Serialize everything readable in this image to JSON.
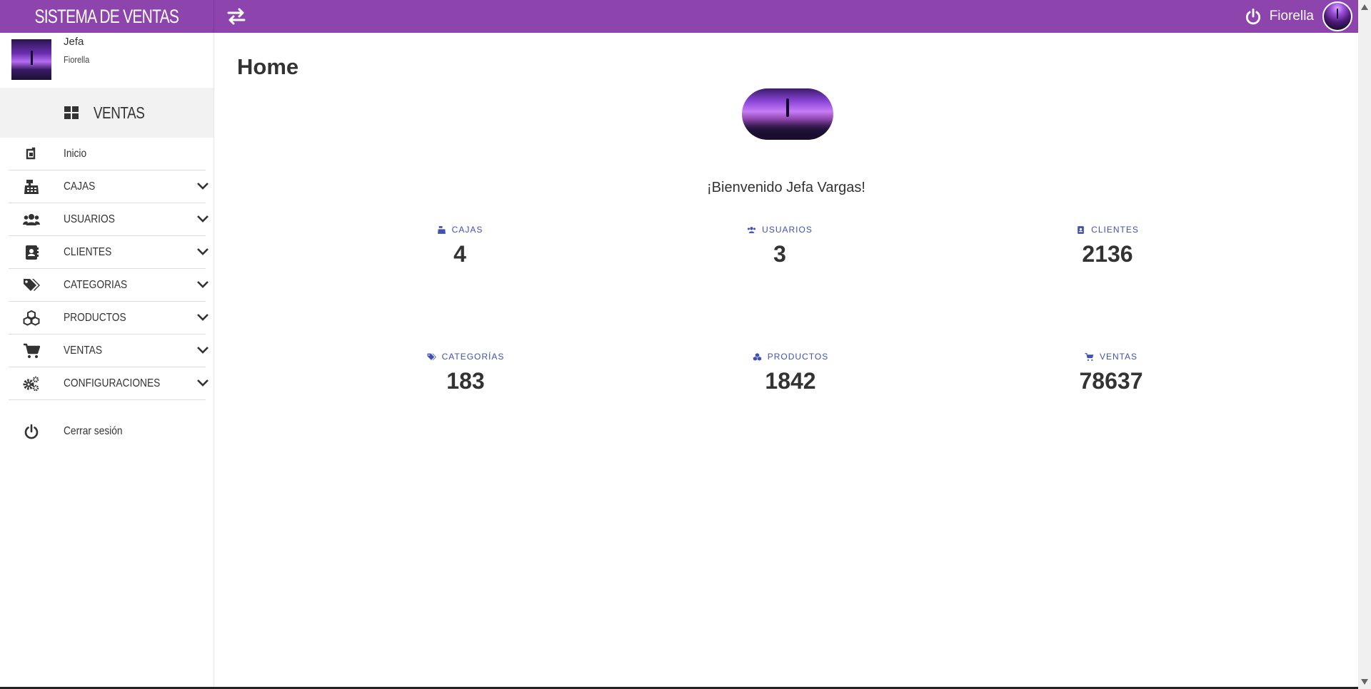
{
  "app": {
    "title": "SISTEMA DE VENTAS",
    "accent_color": "#8e44ad",
    "stat_label_color": "#3f51b5"
  },
  "topbar": {
    "toggle_icon": "exchange-arrows-icon",
    "power_icon": "power-icon",
    "username": "Fiorella",
    "avatar": "user-avatar"
  },
  "sidebar": {
    "profile": {
      "name": "Jefa",
      "subtitle": "Fiorella"
    },
    "section": {
      "icon": "grid-icon",
      "label": "VENTAS"
    },
    "items": [
      {
        "label": "Inicio",
        "icon": "home-icon",
        "has_chevron": false
      },
      {
        "label": "CAJAS",
        "icon": "cash-register-icon",
        "has_chevron": true
      },
      {
        "label": "USUARIOS",
        "icon": "users-icon",
        "has_chevron": true
      },
      {
        "label": "CLIENTES",
        "icon": "address-book-icon",
        "has_chevron": true
      },
      {
        "label": "CATEGORIAS",
        "icon": "tags-icon",
        "has_chevron": true
      },
      {
        "label": "PRODUCTOS",
        "icon": "cubes-icon",
        "has_chevron": true
      },
      {
        "label": "VENTAS",
        "icon": "shopping-cart-icon",
        "has_chevron": true
      },
      {
        "label": "CONFIGURACIONES",
        "icon": "cogs-icon",
        "has_chevron": true
      }
    ],
    "logout": {
      "label": "Cerrar sesión",
      "icon": "power-icon"
    }
  },
  "main": {
    "page_title": "Home",
    "welcome": "¡Bienvenido Jefa Vargas!",
    "stats": [
      {
        "label": "CAJAS",
        "value": "4",
        "icon": "cash-register-icon"
      },
      {
        "label": "USUARIOS",
        "value": "3",
        "icon": "users-icon"
      },
      {
        "label": "CLIENTES",
        "value": "2136",
        "icon": "address-book-icon"
      },
      {
        "label": "CATEGORÍAS",
        "value": "183",
        "icon": "tags-icon"
      },
      {
        "label": "PRODUCTOS",
        "value": "1842",
        "icon": "cubes-icon"
      },
      {
        "label": "VENTAS",
        "value": "78637",
        "icon": "shopping-cart-icon"
      }
    ]
  }
}
